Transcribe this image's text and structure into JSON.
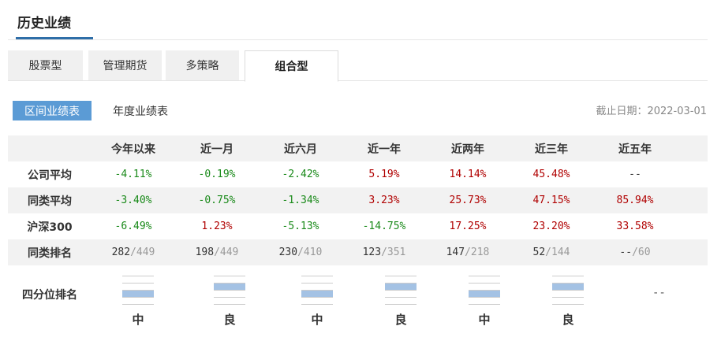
{
  "section_title": "历史业绩",
  "tabs": [
    {
      "label": "股票型",
      "active": false
    },
    {
      "label": "管理期货",
      "active": false
    },
    {
      "label": "多策略",
      "active": false
    },
    {
      "label": "组合型",
      "active": true
    }
  ],
  "sub_tabs": [
    {
      "label": "区间业绩表",
      "active": true
    },
    {
      "label": "年度业绩表",
      "active": false
    }
  ],
  "deadline": "截止日期：2022-03-01",
  "table": {
    "columns": [
      "今年以来",
      "近一月",
      "近六月",
      "近一年",
      "近两年",
      "近三年",
      "近五年"
    ],
    "rows": [
      {
        "label": "公司平均",
        "values": [
          "-4.11%",
          "-0.19%",
          "-2.42%",
          "5.19%",
          "14.14%",
          "45.48%",
          "--"
        ]
      },
      {
        "label": "同类平均",
        "values": [
          "-3.40%",
          "-0.75%",
          "-1.34%",
          "3.23%",
          "25.73%",
          "47.15%",
          "85.94%"
        ]
      },
      {
        "label": "沪深300",
        "values": [
          "-6.49%",
          "1.23%",
          "-5.13%",
          "-14.75%",
          "17.25%",
          "23.20%",
          "33.58%"
        ]
      }
    ],
    "rank_row": {
      "label": "同类排名",
      "ranks": [
        {
          "rank": "282",
          "total": "/449"
        },
        {
          "rank": "198",
          "total": "/449"
        },
        {
          "rank": "230",
          "total": "/410"
        },
        {
          "rank": "123",
          "total": "/351"
        },
        {
          "rank": "147",
          "total": "/218"
        },
        {
          "rank": "52",
          "total": "/144"
        },
        {
          "rank": "--",
          "total": "/60"
        }
      ]
    }
  },
  "quartile": {
    "label": "四分位排名",
    "items": [
      {
        "grade": "中",
        "quartile": 3
      },
      {
        "grade": "良",
        "quartile": 2
      },
      {
        "grade": "中",
        "quartile": 3
      },
      {
        "grade": "良",
        "quartile": 2
      },
      {
        "grade": "中",
        "quartile": 3
      },
      {
        "grade": "良",
        "quartile": 2
      },
      {
        "grade": "--",
        "quartile": null
      }
    ]
  }
}
